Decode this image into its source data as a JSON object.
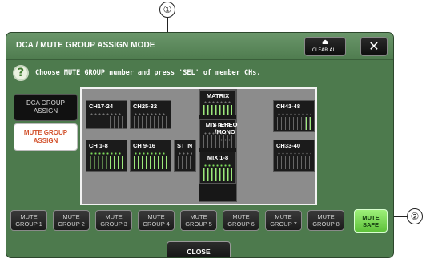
{
  "callouts": {
    "one": "①",
    "two": "②"
  },
  "window": {
    "title": "DCA / MUTE GROUP ASSIGN MODE",
    "clear_all_label": "CLEAR ALL",
    "clear_all_icon": "⏏",
    "close_icon": "✕"
  },
  "help": {
    "icon": "?",
    "instruction": "Choose MUTE GROUP number and press 'SEL' of member CHs."
  },
  "mode_buttons": [
    {
      "label": "DCA GROUP ASSIGN",
      "state": "inactive"
    },
    {
      "label": "MUTE GROUP ASSIGN",
      "state": "active"
    }
  ],
  "panel": {
    "channel_blocks": [
      "CH17-24",
      "CH25-32",
      "CH 1-8",
      "CH 9-16",
      "ST IN",
      "CH41-48",
      "CH33-40"
    ],
    "center_blocks": [
      "MATRIX",
      "MIX 9-16",
      "MIX 1-8"
    ],
    "stereo_label": "STEREO /MONO"
  },
  "mute_groups": [
    "MUTE GROUP 1",
    "MUTE GROUP 2",
    "MUTE GROUP 3",
    "MUTE GROUP 4",
    "MUTE GROUP 5",
    "MUTE GROUP 6",
    "MUTE GROUP 7",
    "MUTE GROUP 8"
  ],
  "mute_safe_label": "MUTE SAFE",
  "close_label": "CLOSE",
  "colors": {
    "window_bg": "#4d7a4d",
    "active_mode_text": "#d2502a",
    "mute_safe_bg": "#7ad85a"
  }
}
